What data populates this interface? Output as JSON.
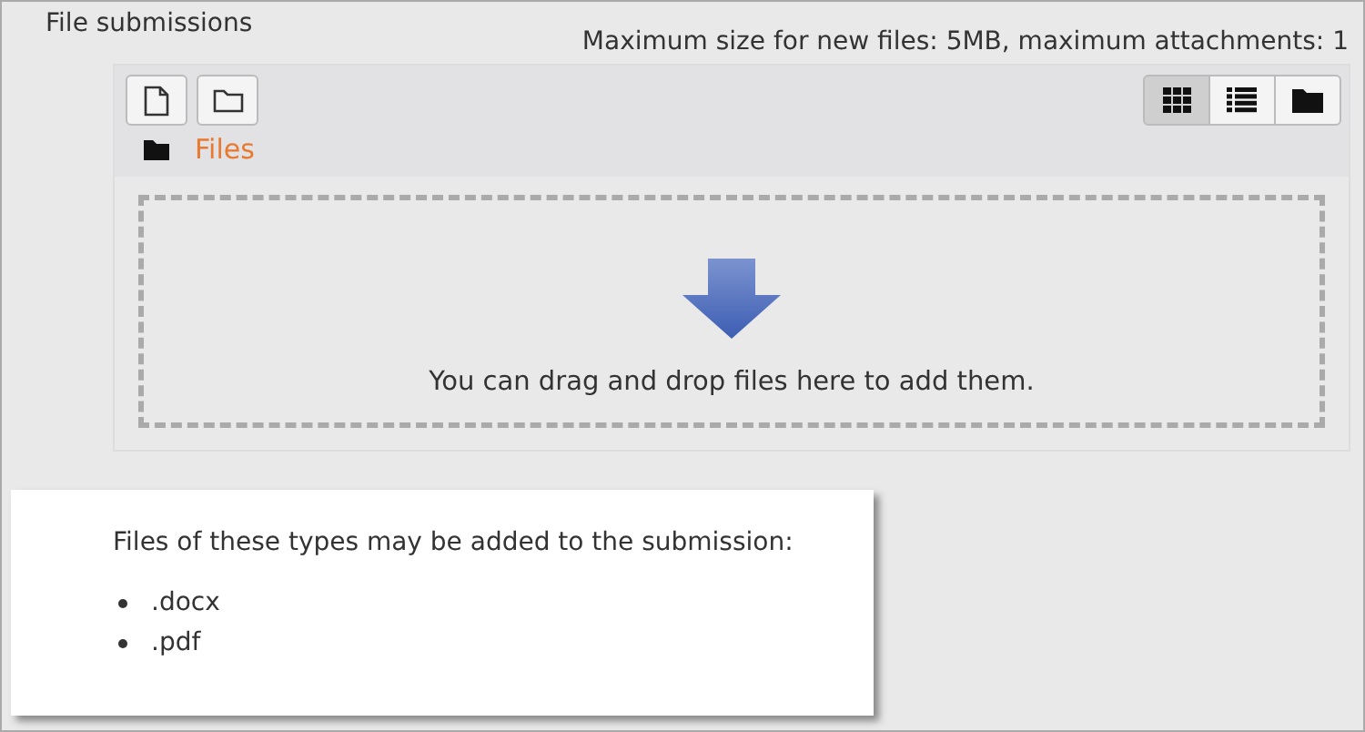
{
  "label": "File submissions",
  "limits": "Maximum size for new files: 5MB, maximum attachments: 1",
  "file_manager": {
    "actions": [
      {
        "kind": "file"
      },
      {
        "kind": "folder"
      }
    ],
    "view_buttons": [
      {
        "kind": "grid",
        "selected": true
      },
      {
        "kind": "list",
        "selected": false
      },
      {
        "kind": "tree",
        "selected": false
      }
    ],
    "path": "Files",
    "dropzone": "You can drag and drop files here to add them."
  },
  "accepted_types": {
    "intro": "Files of these types may be added to the submission:",
    "items": [
      ".docx",
      ".pdf"
    ]
  }
}
